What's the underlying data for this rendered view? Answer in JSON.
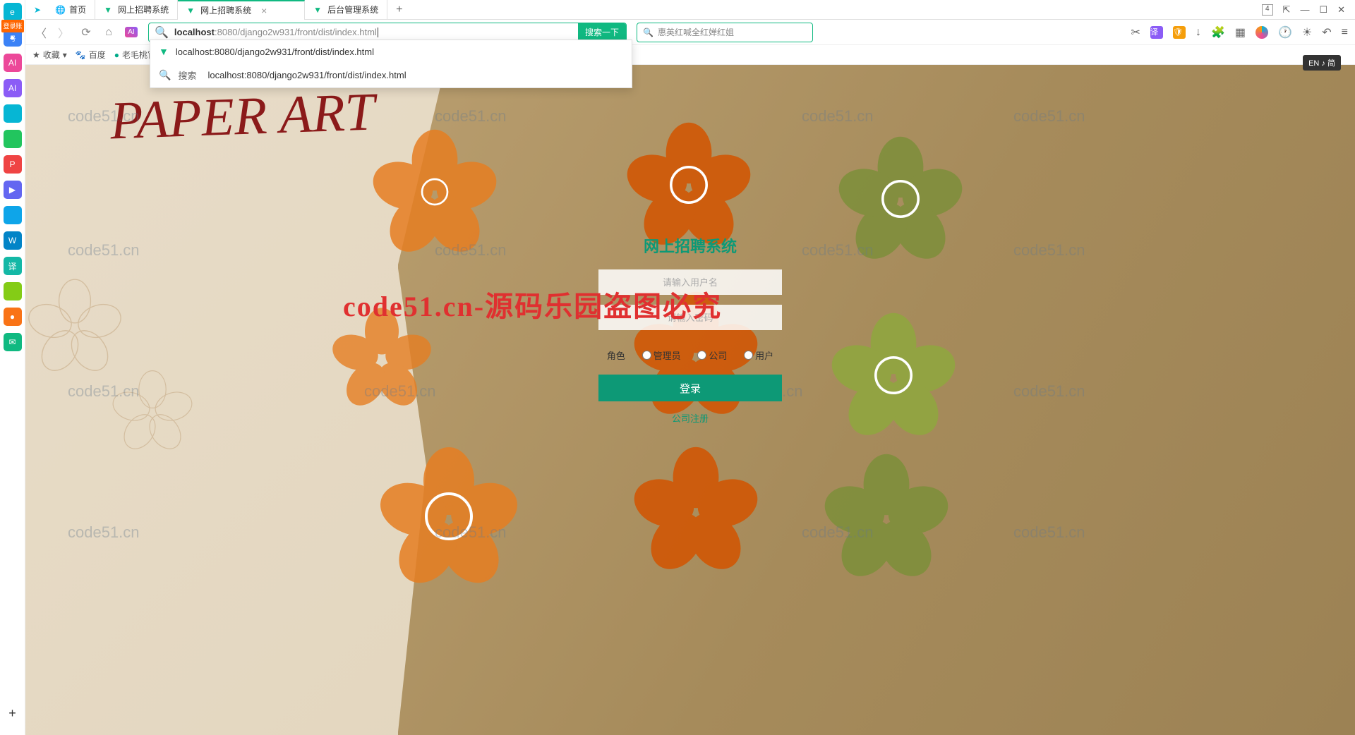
{
  "tabs": [
    {
      "label": "首页",
      "icon_color": "#888"
    },
    {
      "label": "网上招聘系统",
      "icon_color": "#10b981"
    },
    {
      "label": "网上招聘系统",
      "icon_color": "#10b981",
      "active": true
    },
    {
      "label": "后台管理系统",
      "icon_color": "#10b981"
    }
  ],
  "window_controls": {
    "count": "4"
  },
  "toolbar": {
    "url_domain": "localhost",
    "url_path": ":8080/django2w931/front/dist/index.html",
    "search_btn": "搜索一下",
    "second_search_placeholder": "惠英红喊全红婵红姐"
  },
  "suggestions": [
    {
      "type": "url",
      "text": "localhost:8080/django2w931/front/dist/index.html"
    },
    {
      "type": "search",
      "label": "搜索",
      "text": "localhost:8080/django2w931/front/dist/index.html"
    }
  ],
  "bookmarks": {
    "fav": "收藏",
    "items": [
      {
        "label": "百度",
        "color": "#e03"
      },
      {
        "label": "老毛桃官网",
        "color": "#0a8"
      }
    ]
  },
  "login_badge": "登录账号",
  "lang_badge": "EN ♪ 简",
  "paper_title": "PAPER ART",
  "login": {
    "title": "网上招聘系统",
    "username_placeholder": "请输入用户名",
    "password_placeholder": "请输入密码",
    "role_label": "角色",
    "roles": [
      "管理员",
      "公司",
      "用户"
    ],
    "submit": "登录",
    "register": "公司注册"
  },
  "watermark_text": "code51.cn",
  "watermark_main": "code51.cn-源码乐园盗图必究"
}
